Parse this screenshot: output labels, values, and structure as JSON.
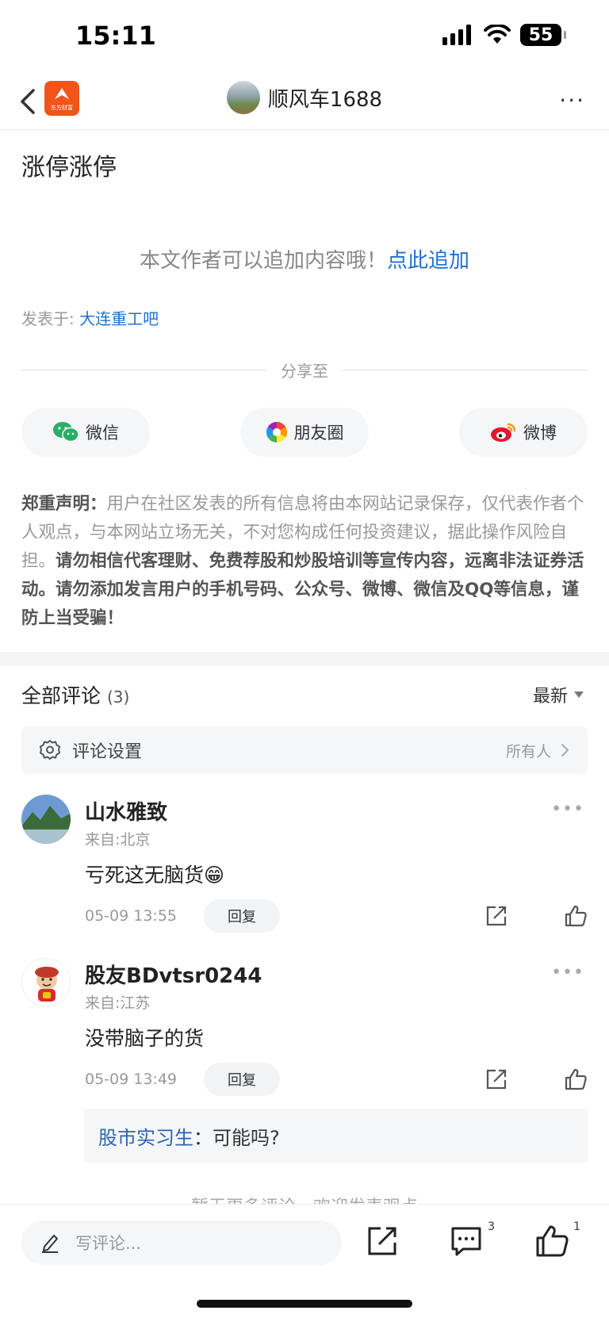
{
  "status": {
    "time": "15:11",
    "battery": "55"
  },
  "nav": {
    "logo_text": "东方财富",
    "title": "顺风车1688",
    "more": "···"
  },
  "post": {
    "title": "涨停涨停",
    "append_text": "本文作者可以追加内容哦！",
    "append_link": "点此追加",
    "posted_prefix": "发表于: ",
    "posted_board": "大连重工吧"
  },
  "share": {
    "heading": "分享至",
    "options": [
      "微信",
      "朋友圈",
      "微博"
    ]
  },
  "disclaimer": {
    "label": "郑重声明：",
    "normal": "用户在社区发表的所有信息将由本网站记录保存，仅代表作者个人观点，与本网站立场无关，不对您构成任何投资建议，据此操作风险自担。",
    "bold": "请勿相信代客理财、免费荐股和炒股培训等宣传内容，远离非法证券活动。请勿添加发言用户的手机号码、公众号、微博、微信及QQ等信息，谨防上当受骗！"
  },
  "comments": {
    "heading": "全部评论",
    "count": "(3)",
    "sort": "最新",
    "settings_label": "评论设置",
    "settings_value": "所有人",
    "items": [
      {
        "name": "山水雅致",
        "location": "来自:北京",
        "text": "亏死这无脑货😁",
        "time": "05-09 13:55",
        "reply": "回复"
      },
      {
        "name": "股友BDvtsr0244",
        "location": "来自:江苏",
        "text": "没带脑子的货",
        "time": "05-09 13:49",
        "reply": "回复"
      }
    ],
    "sub_reply": {
      "user": "股市实习生",
      "sep": "：",
      "text": "可能吗?"
    },
    "no_more": "暂无更多评论，欢迎发表观点"
  },
  "bottom": {
    "write_placeholder": "写评论...",
    "comment_badge": "3",
    "like_badge": "1"
  }
}
